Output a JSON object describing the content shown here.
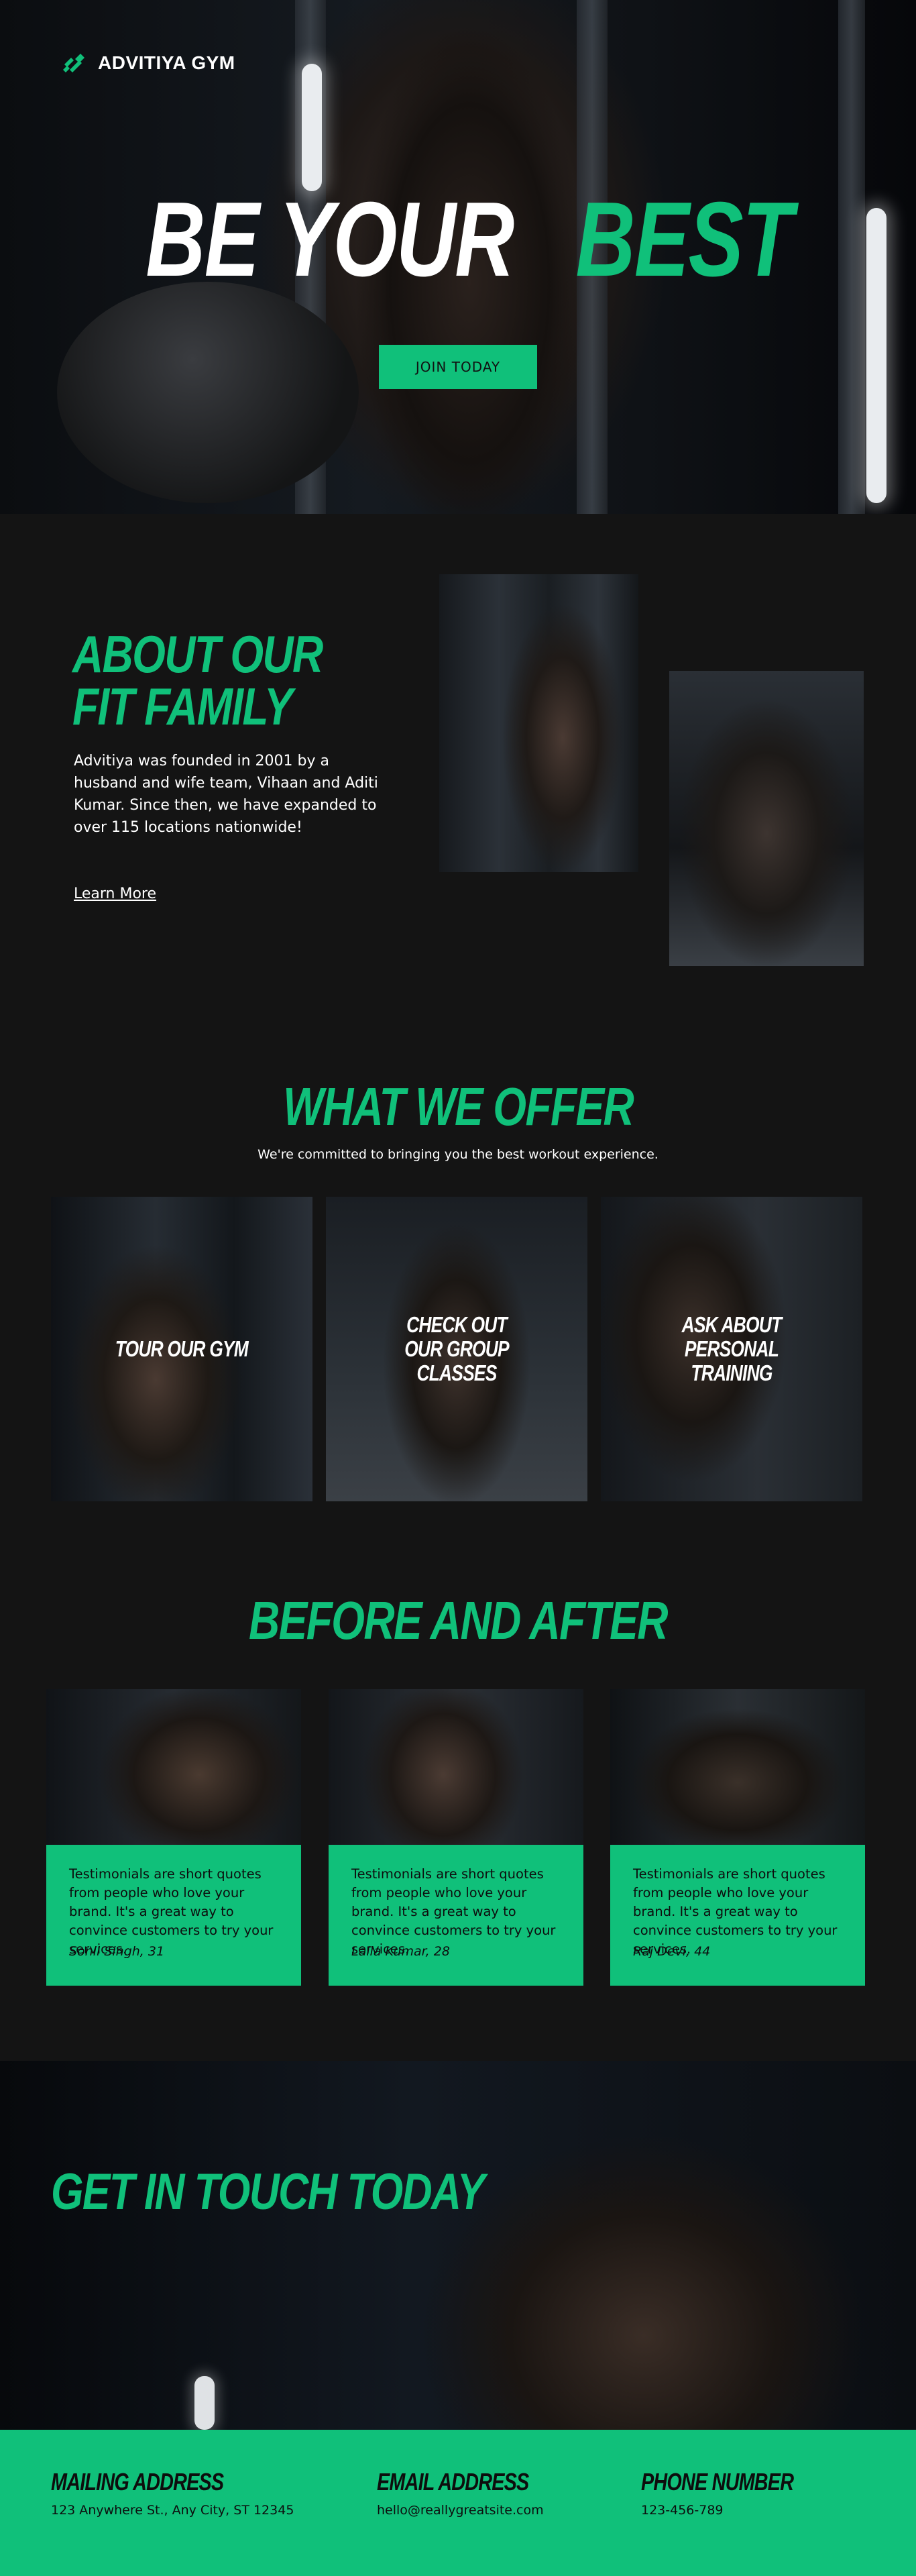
{
  "brand": {
    "name": "ADVITIYA GYM",
    "accent": "#10c07a"
  },
  "hero": {
    "title_white": "BE YOUR",
    "title_green": "BEST",
    "cta": "JOIN TODAY"
  },
  "about": {
    "title": "ABOUT OUR FIT FAMILY",
    "text": "Advitiya was founded in 2001 by a husband and wife team, Vihaan and Aditi Kumar. Since then, we have expanded to over 115 locations nationwide!",
    "link": "Learn More"
  },
  "offer": {
    "title": "WHAT WE OFFER",
    "subtitle": "We're committed to bringing you the best workout experience.",
    "cards": [
      {
        "label": "TOUR OUR GYM"
      },
      {
        "label": "CHECK OUT OUR GROUP CLASSES"
      },
      {
        "label": "ASK ABOUT PERSONAL TRAINING"
      }
    ]
  },
  "before_after": {
    "title": "BEFORE AND AFTER",
    "testimonials": [
      {
        "quote": "Testimonials are short quotes from people who love your brand. It's a great way to convince customers to try your services.",
        "name": "Sonil Singh, 31"
      },
      {
        "quote": "Testimonials are short quotes from people who love your brand. It's a great way to convince customers to try your services.",
        "name": "Laila Kumar, 28"
      },
      {
        "quote": "Testimonials are short quotes from people who love your brand. It's a great way to convince customers to try your services.",
        "name": "Raj Devi, 44"
      }
    ]
  },
  "contact": {
    "title": "GET IN TOUCH TODAY",
    "mailing": {
      "label": "MAILING ADDRESS",
      "value": "123 Anywhere St., Any City, ST 12345"
    },
    "email": {
      "label": "EMAIL ADDRESS",
      "value": "hello@reallygreatsite.com"
    },
    "phone": {
      "label": "PHONE NUMBER",
      "value": "123-456-789"
    }
  }
}
